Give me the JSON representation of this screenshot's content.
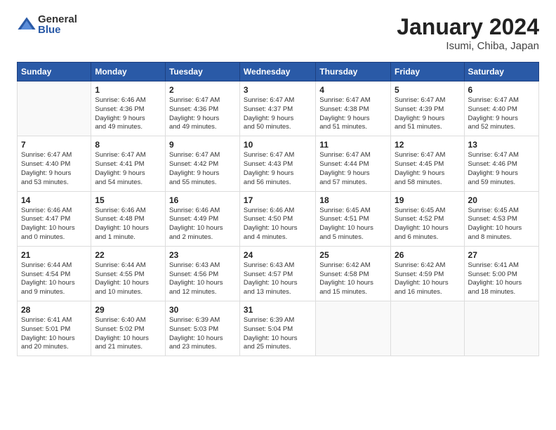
{
  "header": {
    "logo_general": "General",
    "logo_blue": "Blue",
    "title": "January 2024",
    "subtitle": "Isumi, Chiba, Japan"
  },
  "weekdays": [
    "Sunday",
    "Monday",
    "Tuesday",
    "Wednesday",
    "Thursday",
    "Friday",
    "Saturday"
  ],
  "weeks": [
    [
      {
        "day": "",
        "empty": true
      },
      {
        "day": "1",
        "line1": "Sunrise: 6:46 AM",
        "line2": "Sunset: 4:36 PM",
        "line3": "Daylight: 9 hours",
        "line4": "and 49 minutes."
      },
      {
        "day": "2",
        "line1": "Sunrise: 6:47 AM",
        "line2": "Sunset: 4:36 PM",
        "line3": "Daylight: 9 hours",
        "line4": "and 49 minutes."
      },
      {
        "day": "3",
        "line1": "Sunrise: 6:47 AM",
        "line2": "Sunset: 4:37 PM",
        "line3": "Daylight: 9 hours",
        "line4": "and 50 minutes."
      },
      {
        "day": "4",
        "line1": "Sunrise: 6:47 AM",
        "line2": "Sunset: 4:38 PM",
        "line3": "Daylight: 9 hours",
        "line4": "and 51 minutes."
      },
      {
        "day": "5",
        "line1": "Sunrise: 6:47 AM",
        "line2": "Sunset: 4:39 PM",
        "line3": "Daylight: 9 hours",
        "line4": "and 51 minutes."
      },
      {
        "day": "6",
        "line1": "Sunrise: 6:47 AM",
        "line2": "Sunset: 4:40 PM",
        "line3": "Daylight: 9 hours",
        "line4": "and 52 minutes."
      }
    ],
    [
      {
        "day": "7",
        "line1": "Sunrise: 6:47 AM",
        "line2": "Sunset: 4:40 PM",
        "line3": "Daylight: 9 hours",
        "line4": "and 53 minutes."
      },
      {
        "day": "8",
        "line1": "Sunrise: 6:47 AM",
        "line2": "Sunset: 4:41 PM",
        "line3": "Daylight: 9 hours",
        "line4": "and 54 minutes."
      },
      {
        "day": "9",
        "line1": "Sunrise: 6:47 AM",
        "line2": "Sunset: 4:42 PM",
        "line3": "Daylight: 9 hours",
        "line4": "and 55 minutes."
      },
      {
        "day": "10",
        "line1": "Sunrise: 6:47 AM",
        "line2": "Sunset: 4:43 PM",
        "line3": "Daylight: 9 hours",
        "line4": "and 56 minutes."
      },
      {
        "day": "11",
        "line1": "Sunrise: 6:47 AM",
        "line2": "Sunset: 4:44 PM",
        "line3": "Daylight: 9 hours",
        "line4": "and 57 minutes."
      },
      {
        "day": "12",
        "line1": "Sunrise: 6:47 AM",
        "line2": "Sunset: 4:45 PM",
        "line3": "Daylight: 9 hours",
        "line4": "and 58 minutes."
      },
      {
        "day": "13",
        "line1": "Sunrise: 6:47 AM",
        "line2": "Sunset: 4:46 PM",
        "line3": "Daylight: 9 hours",
        "line4": "and 59 minutes."
      }
    ],
    [
      {
        "day": "14",
        "line1": "Sunrise: 6:46 AM",
        "line2": "Sunset: 4:47 PM",
        "line3": "Daylight: 10 hours",
        "line4": "and 0 minutes."
      },
      {
        "day": "15",
        "line1": "Sunrise: 6:46 AM",
        "line2": "Sunset: 4:48 PM",
        "line3": "Daylight: 10 hours",
        "line4": "and 1 minute."
      },
      {
        "day": "16",
        "line1": "Sunrise: 6:46 AM",
        "line2": "Sunset: 4:49 PM",
        "line3": "Daylight: 10 hours",
        "line4": "and 2 minutes."
      },
      {
        "day": "17",
        "line1": "Sunrise: 6:46 AM",
        "line2": "Sunset: 4:50 PM",
        "line3": "Daylight: 10 hours",
        "line4": "and 4 minutes."
      },
      {
        "day": "18",
        "line1": "Sunrise: 6:45 AM",
        "line2": "Sunset: 4:51 PM",
        "line3": "Daylight: 10 hours",
        "line4": "and 5 minutes."
      },
      {
        "day": "19",
        "line1": "Sunrise: 6:45 AM",
        "line2": "Sunset: 4:52 PM",
        "line3": "Daylight: 10 hours",
        "line4": "and 6 minutes."
      },
      {
        "day": "20",
        "line1": "Sunrise: 6:45 AM",
        "line2": "Sunset: 4:53 PM",
        "line3": "Daylight: 10 hours",
        "line4": "and 8 minutes."
      }
    ],
    [
      {
        "day": "21",
        "line1": "Sunrise: 6:44 AM",
        "line2": "Sunset: 4:54 PM",
        "line3": "Daylight: 10 hours",
        "line4": "and 9 minutes."
      },
      {
        "day": "22",
        "line1": "Sunrise: 6:44 AM",
        "line2": "Sunset: 4:55 PM",
        "line3": "Daylight: 10 hours",
        "line4": "and 10 minutes."
      },
      {
        "day": "23",
        "line1": "Sunrise: 6:43 AM",
        "line2": "Sunset: 4:56 PM",
        "line3": "Daylight: 10 hours",
        "line4": "and 12 minutes."
      },
      {
        "day": "24",
        "line1": "Sunrise: 6:43 AM",
        "line2": "Sunset: 4:57 PM",
        "line3": "Daylight: 10 hours",
        "line4": "and 13 minutes."
      },
      {
        "day": "25",
        "line1": "Sunrise: 6:42 AM",
        "line2": "Sunset: 4:58 PM",
        "line3": "Daylight: 10 hours",
        "line4": "and 15 minutes."
      },
      {
        "day": "26",
        "line1": "Sunrise: 6:42 AM",
        "line2": "Sunset: 4:59 PM",
        "line3": "Daylight: 10 hours",
        "line4": "and 16 minutes."
      },
      {
        "day": "27",
        "line1": "Sunrise: 6:41 AM",
        "line2": "Sunset: 5:00 PM",
        "line3": "Daylight: 10 hours",
        "line4": "and 18 minutes."
      }
    ],
    [
      {
        "day": "28",
        "line1": "Sunrise: 6:41 AM",
        "line2": "Sunset: 5:01 PM",
        "line3": "Daylight: 10 hours",
        "line4": "and 20 minutes."
      },
      {
        "day": "29",
        "line1": "Sunrise: 6:40 AM",
        "line2": "Sunset: 5:02 PM",
        "line3": "Daylight: 10 hours",
        "line4": "and 21 minutes."
      },
      {
        "day": "30",
        "line1": "Sunrise: 6:39 AM",
        "line2": "Sunset: 5:03 PM",
        "line3": "Daylight: 10 hours",
        "line4": "and 23 minutes."
      },
      {
        "day": "31",
        "line1": "Sunrise: 6:39 AM",
        "line2": "Sunset: 5:04 PM",
        "line3": "Daylight: 10 hours",
        "line4": "and 25 minutes."
      },
      {
        "day": "",
        "empty": true
      },
      {
        "day": "",
        "empty": true
      },
      {
        "day": "",
        "empty": true
      }
    ]
  ]
}
